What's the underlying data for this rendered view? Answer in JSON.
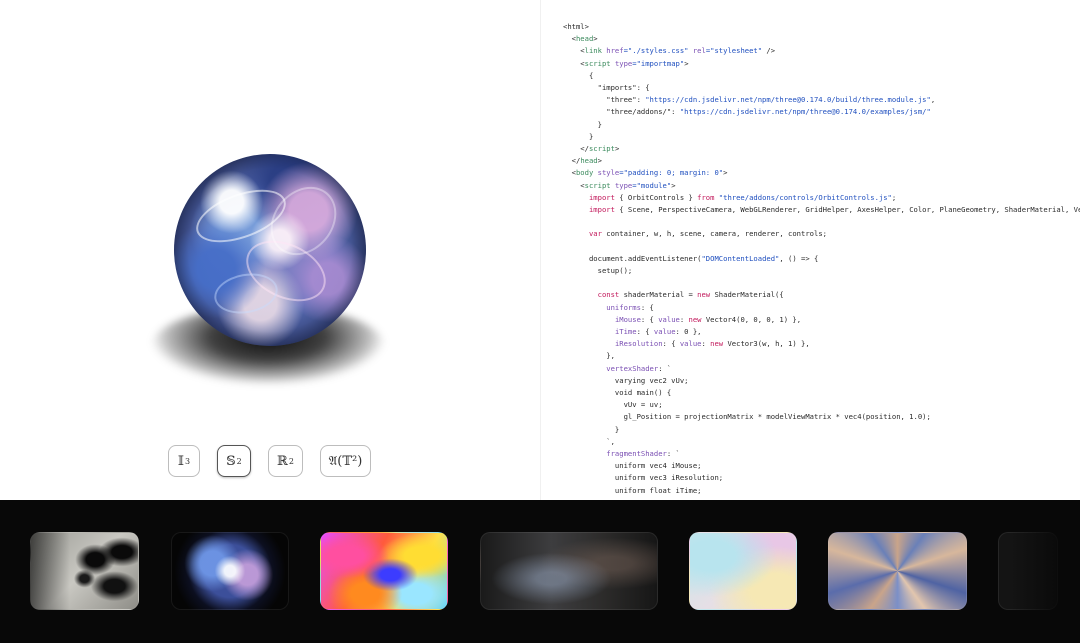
{
  "preview": {
    "buttons": [
      {
        "label": "𝕀",
        "sup": "3",
        "active": false
      },
      {
        "label": "𝕊",
        "sup": "2",
        "active": true
      },
      {
        "label": "ℝ",
        "sup": "2",
        "active": false
      },
      {
        "label": "𝔄(𝕋²)",
        "sup": "",
        "active": false
      }
    ]
  },
  "code": {
    "lines": [
      [
        {
          "t": "<html>",
          "c": "plain"
        }
      ],
      [
        {
          "t": "  <",
          "c": "plain"
        },
        {
          "t": "head",
          "c": "tag"
        },
        {
          "t": ">",
          "c": "plain"
        }
      ],
      [
        {
          "t": "    <",
          "c": "plain"
        },
        {
          "t": "link ",
          "c": "tag"
        },
        {
          "t": "href",
          "c": "attr"
        },
        {
          "t": "=\"./styles.css\" ",
          "c": "str"
        },
        {
          "t": "rel",
          "c": "attr"
        },
        {
          "t": "=\"stylesheet\"",
          "c": "str"
        },
        {
          "t": " />",
          "c": "plain"
        }
      ],
      [
        {
          "t": "    <",
          "c": "plain"
        },
        {
          "t": "script ",
          "c": "tag"
        },
        {
          "t": "type",
          "c": "attr"
        },
        {
          "t": "=\"importmap\"",
          "c": "str"
        },
        {
          "t": ">",
          "c": "plain"
        }
      ],
      [
        {
          "t": "      {",
          "c": "plain"
        }
      ],
      [
        {
          "t": "        \"imports\": {",
          "c": "plain"
        }
      ],
      [
        {
          "t": "          \"three\": ",
          "c": "plain"
        },
        {
          "t": "\"https://cdn.jsdelivr.net/npm/three@0.174.0/build/three.module.js\"",
          "c": "str"
        },
        {
          "t": ",",
          "c": "plain"
        }
      ],
      [
        {
          "t": "          \"three/addons/\": ",
          "c": "plain"
        },
        {
          "t": "\"https://cdn.jsdelivr.net/npm/three@0.174.0/examples/jsm/\"",
          "c": "str"
        }
      ],
      [
        {
          "t": "        }",
          "c": "plain"
        }
      ],
      [
        {
          "t": "      }",
          "c": "plain"
        }
      ],
      [
        {
          "t": "    </",
          "c": "plain"
        },
        {
          "t": "script",
          "c": "tag"
        },
        {
          "t": ">",
          "c": "plain"
        }
      ],
      [
        {
          "t": "  </",
          "c": "plain"
        },
        {
          "t": "head",
          "c": "tag"
        },
        {
          "t": ">",
          "c": "plain"
        }
      ],
      [
        {
          "t": "  <",
          "c": "plain"
        },
        {
          "t": "body ",
          "c": "tag"
        },
        {
          "t": "style",
          "c": "attr"
        },
        {
          "t": "=\"padding: 0; margin: 0\"",
          "c": "str"
        },
        {
          "t": ">",
          "c": "plain"
        }
      ],
      [
        {
          "t": "    <",
          "c": "plain"
        },
        {
          "t": "script ",
          "c": "tag"
        },
        {
          "t": "type",
          "c": "attr"
        },
        {
          "t": "=\"module\"",
          "c": "str"
        },
        {
          "t": ">",
          "c": "plain"
        }
      ],
      [
        {
          "t": "      ",
          "c": "plain"
        },
        {
          "t": "import",
          "c": "kw"
        },
        {
          "t": " { OrbitControls } ",
          "c": "plain"
        },
        {
          "t": "from",
          "c": "kw"
        },
        {
          "t": " ",
          "c": "plain"
        },
        {
          "t": "\"three/addons/controls/OrbitControls.js\"",
          "c": "str"
        },
        {
          "t": ";",
          "c": "plain"
        }
      ],
      [
        {
          "t": "      ",
          "c": "plain"
        },
        {
          "t": "import",
          "c": "kw"
        },
        {
          "t": " { Scene, PerspectiveCamera, WebGLRenderer, GridHelper, AxesHelper, Color, PlaneGeometry, ShaderMaterial, Vector3, Vecto",
          "c": "plain"
        }
      ],
      [
        {
          "t": "",
          "c": "plain"
        }
      ],
      [
        {
          "t": "      ",
          "c": "plain"
        },
        {
          "t": "var",
          "c": "kw"
        },
        {
          "t": " container, w, h, scene, camera, renderer, controls;",
          "c": "plain"
        }
      ],
      [
        {
          "t": "",
          "c": "plain"
        }
      ],
      [
        {
          "t": "      document.addEventListener(",
          "c": "plain"
        },
        {
          "t": "\"DOMContentLoaded\"",
          "c": "str"
        },
        {
          "t": ", () => {",
          "c": "plain"
        }
      ],
      [
        {
          "t": "        setup();",
          "c": "plain"
        }
      ],
      [
        {
          "t": "",
          "c": "plain"
        }
      ],
      [
        {
          "t": "        ",
          "c": "plain"
        },
        {
          "t": "const",
          "c": "kw"
        },
        {
          "t": " shaderMaterial = ",
          "c": "plain"
        },
        {
          "t": "new",
          "c": "kw"
        },
        {
          "t": " ShaderMaterial({",
          "c": "plain"
        }
      ],
      [
        {
          "t": "          ",
          "c": "plain"
        },
        {
          "t": "uniforms",
          "c": "prop"
        },
        {
          "t": ": {",
          "c": "plain"
        }
      ],
      [
        {
          "t": "            ",
          "c": "plain"
        },
        {
          "t": "iMouse",
          "c": "prop"
        },
        {
          "t": ": { ",
          "c": "plain"
        },
        {
          "t": "value",
          "c": "prop"
        },
        {
          "t": ": ",
          "c": "plain"
        },
        {
          "t": "new",
          "c": "kw"
        },
        {
          "t": " Vector4(0, 0, 0, 1) },",
          "c": "plain"
        }
      ],
      [
        {
          "t": "            ",
          "c": "plain"
        },
        {
          "t": "iTime",
          "c": "prop"
        },
        {
          "t": ": { ",
          "c": "plain"
        },
        {
          "t": "value",
          "c": "prop"
        },
        {
          "t": ": 0 },",
          "c": "plain"
        }
      ],
      [
        {
          "t": "            ",
          "c": "plain"
        },
        {
          "t": "iResolution",
          "c": "prop"
        },
        {
          "t": ": { ",
          "c": "plain"
        },
        {
          "t": "value",
          "c": "prop"
        },
        {
          "t": ": ",
          "c": "plain"
        },
        {
          "t": "new",
          "c": "kw"
        },
        {
          "t": " Vector3(w, h, 1) },",
          "c": "plain"
        }
      ],
      [
        {
          "t": "          },",
          "c": "plain"
        }
      ],
      [
        {
          "t": "          ",
          "c": "plain"
        },
        {
          "t": "vertexShader",
          "c": "prop"
        },
        {
          "t": ": `",
          "c": "plain"
        }
      ],
      [
        {
          "t": "            varying vec2 vUv;",
          "c": "plain"
        }
      ],
      [
        {
          "t": "            void main() {",
          "c": "plain"
        }
      ],
      [
        {
          "t": "              vUv = uv;",
          "c": "plain"
        }
      ],
      [
        {
          "t": "              gl_Position = projectionMatrix * modelViewMatrix * vec4(position, 1.0);",
          "c": "plain"
        }
      ],
      [
        {
          "t": "            }",
          "c": "plain"
        }
      ],
      [
        {
          "t": "          `,",
          "c": "plain"
        }
      ],
      [
        {
          "t": "          ",
          "c": "plain"
        },
        {
          "t": "fragmentShader",
          "c": "prop"
        },
        {
          "t": ": `",
          "c": "plain"
        }
      ],
      [
        {
          "t": "            uniform vec4 iMouse;",
          "c": "plain"
        }
      ],
      [
        {
          "t": "            uniform vec3 iResolution;",
          "c": "plain"
        }
      ],
      [
        {
          "t": "            uniform float iTime;",
          "c": "plain"
        }
      ]
    ]
  },
  "gallery": {
    "thumbs": [
      {
        "name": "ink-splash-thumb"
      },
      {
        "name": "glowing-sphere-thumb"
      },
      {
        "name": "iridescent-swirl-thumb"
      },
      {
        "name": "dark-refraction-thumb"
      },
      {
        "name": "pastel-gradient-thumb"
      },
      {
        "name": "kaleidoscope-thumb"
      },
      {
        "name": "dark-partial-thumb"
      }
    ]
  },
  "colors": {
    "gallery_bg": "#080808",
    "code_tag": "#3a8a5c",
    "code_attr": "#7a4fb3",
    "code_string": "#1f4fbf",
    "code_keyword": "#c2185b"
  }
}
